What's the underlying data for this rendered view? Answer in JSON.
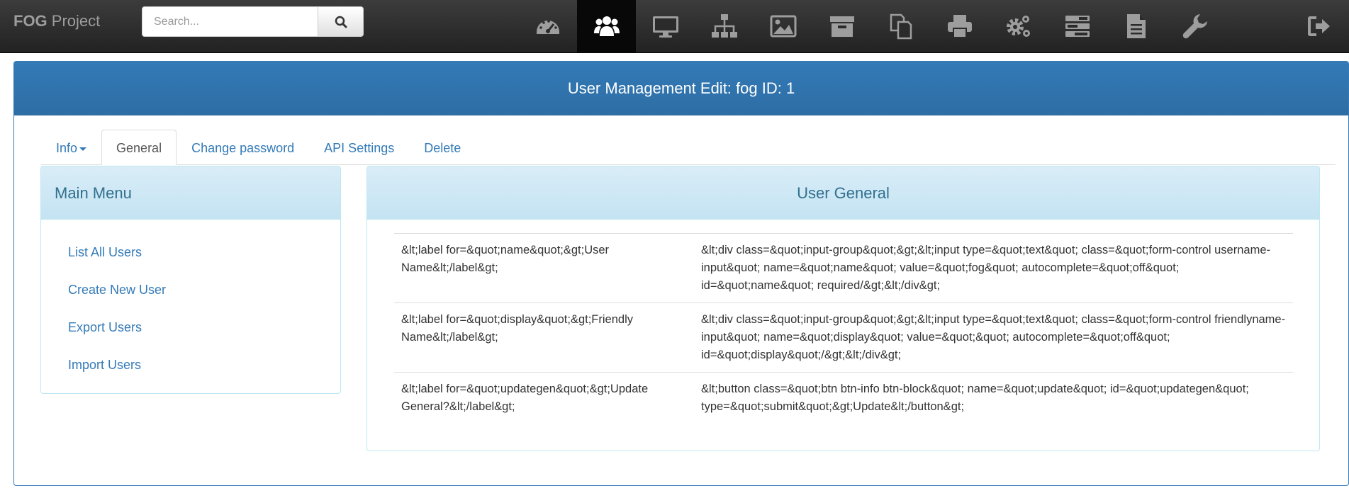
{
  "navbar": {
    "brand_bold": "FOG",
    "brand_rest": " Project",
    "search_placeholder": "Search...",
    "icons": [
      "dashboard-icon",
      "users-icon",
      "hosts-icon",
      "groups-icon",
      "images-icon",
      "storage-icon",
      "snapins-icon",
      "printers-icon",
      "settings-icon",
      "tasks-icon",
      "reports-icon",
      "plugins-icon"
    ],
    "active_icon": "users-icon"
  },
  "page": {
    "title": "User Management Edit: fog ID: 1"
  },
  "tabs": [
    {
      "label": "Info",
      "has_caret": true
    },
    {
      "label": "General",
      "active": true
    },
    {
      "label": "Change password"
    },
    {
      "label": "API Settings"
    },
    {
      "label": "Delete"
    }
  ],
  "main_menu": {
    "title": "Main Menu",
    "items": [
      "List All Users",
      "Create New User",
      "Export Users",
      "Import Users"
    ]
  },
  "user_general": {
    "title": "User General",
    "rows": [
      {
        "label": "&lt;label for=&quot;name&quot;&gt;User Name&lt;/label&gt;",
        "field": "&lt;div class=&quot;input-group&quot;&gt;&lt;input type=&quot;text&quot; class=&quot;form-control username-input&quot; name=&quot;name&quot; value=&quot;fog&quot; autocomplete=&quot;off&quot; id=&quot;name&quot; required/&gt;&lt;/div&gt;"
      },
      {
        "label": "&lt;label for=&quot;display&quot;&gt;Friendly Name&lt;/label&gt;",
        "field": "&lt;div class=&quot;input-group&quot;&gt;&lt;input type=&quot;text&quot; class=&quot;form-control friendlyname-input&quot; name=&quot;display&quot; value=&quot;&quot; autocomplete=&quot;off&quot; id=&quot;display&quot;/&gt;&lt;/div&gt;"
      },
      {
        "label": "&lt;label for=&quot;updategen&quot;&gt;Update General?&lt;/label&gt;",
        "field": "&lt;button class=&quot;btn btn-info btn-block&quot; name=&quot;update&quot; id=&quot;updategen&quot; type=&quot;submit&quot;&gt;Update&lt;/button&gt;"
      }
    ]
  }
}
